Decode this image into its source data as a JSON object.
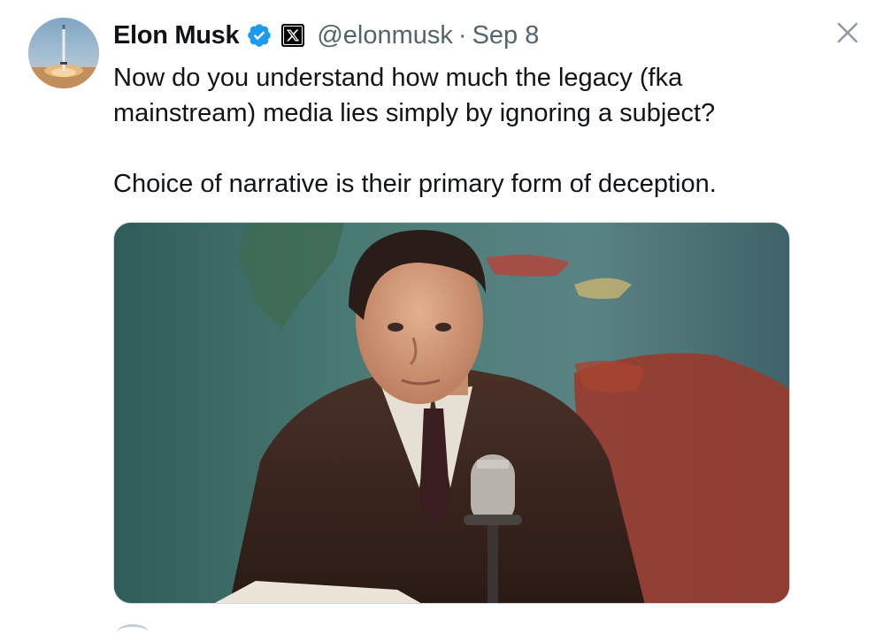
{
  "tweet": {
    "author": {
      "name": "Elon Musk",
      "handle": "@elonmusk",
      "avatar_icon": "rocket-launch-avatar",
      "verified_icon": "verified-badge-icon",
      "affiliation_icon": "x-logo-badge-icon"
    },
    "separator": "·",
    "date": "Sep 8",
    "text": {
      "line1": "Now do you understand how much the legacy (fka",
      "line2": "mainstream) media lies simply by ignoring a subject?",
      "line3": "Choice of narrative is their primary form of deception."
    },
    "media": {
      "type": "photo",
      "alt_icon": "news-anchor-photo"
    },
    "close_icon": "close-icon"
  },
  "colors": {
    "text_primary": "#0f1419",
    "text_secondary": "#536471",
    "verified_blue": "#1d9bf0",
    "border": "#cfd9de",
    "close_gray": "#8b98a5"
  }
}
